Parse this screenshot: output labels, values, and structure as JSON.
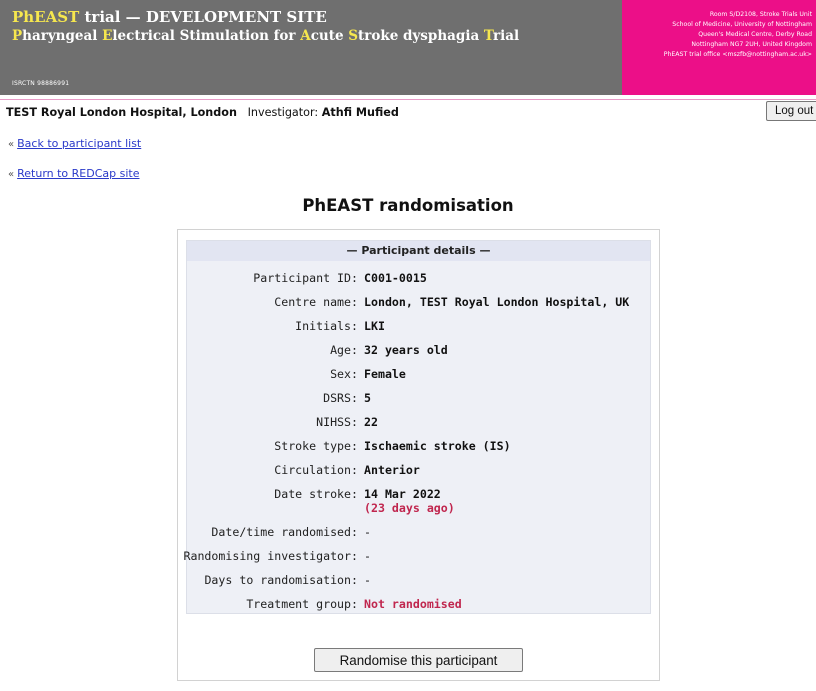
{
  "header": {
    "title_prefix": "PhEAST",
    "title_rest": " trial — DEVELOPMENT SITE",
    "subtitle_parts": [
      {
        "text": "P",
        "hl": true
      },
      {
        "text": "haryngeal ",
        "hl": false
      },
      {
        "text": "E",
        "hl": true
      },
      {
        "text": "lectrical Stimulation for ",
        "hl": false
      },
      {
        "text": "A",
        "hl": true
      },
      {
        "text": "cute ",
        "hl": false
      },
      {
        "text": "S",
        "hl": true
      },
      {
        "text": "troke dysphagia ",
        "hl": false
      },
      {
        "text": "T",
        "hl": true
      },
      {
        "text": "rial",
        "hl": false
      }
    ],
    "isrctn": "ISRCTN 98886991",
    "address_lines": [
      "Room S/D2108, Stroke Trials Unit",
      "School of Medicine, University of Nottingham",
      "Queen's Medical Centre, Derby Road",
      "Nottingham NG7 2UH, United Kingdom",
      "PhEAST trial office <mszfb@nottingham.ac.uk>"
    ]
  },
  "sitebar": {
    "site_name": "TEST Royal London Hospital, London",
    "investigator_label": "Investigator:",
    "investigator_name": "Athfi Mufied",
    "logout_label": "Log out"
  },
  "nav": {
    "prefix": "«",
    "back_label": "Back to participant list",
    "redcap_label": "Return to REDCap site"
  },
  "page_title": "PhEAST randomisation",
  "details": {
    "heading": "— Participant details —",
    "rows": [
      {
        "label": "Participant ID:",
        "value": "C001-0015"
      },
      {
        "label": "Centre name:",
        "value": "London, TEST Royal London Hospital, UK"
      },
      {
        "label": "Initials:",
        "value": "LKI"
      },
      {
        "label": "Age:",
        "value": "32 years old"
      },
      {
        "label": "Sex:",
        "value": "Female"
      },
      {
        "label": "DSRS:",
        "value": "5"
      },
      {
        "label": "NIHSS:",
        "value": "22"
      },
      {
        "label": "Stroke type:",
        "value": "Ischaemic stroke (IS)"
      },
      {
        "label": "Circulation:",
        "value": "Anterior"
      },
      {
        "label": "Date stroke:",
        "value": "14 Mar 2022",
        "sub": "(23 days ago)"
      },
      {
        "label": "Date/time randomised:",
        "value": "-"
      },
      {
        "label": "Randomising investigator:",
        "value": "-"
      },
      {
        "label": "Days to randomisation:",
        "value": "-"
      },
      {
        "label": "Treatment group:",
        "value": "Not randomised"
      }
    ]
  },
  "actions": {
    "randomise_label": "Randomise this participant"
  },
  "colors": {
    "banner_grey": "#6f6f6f",
    "banner_pink": "#ec0f88",
    "highlight_yellow": "#f6e74e",
    "link_blue": "#2a39c9",
    "alert_red": "#c0264e"
  }
}
